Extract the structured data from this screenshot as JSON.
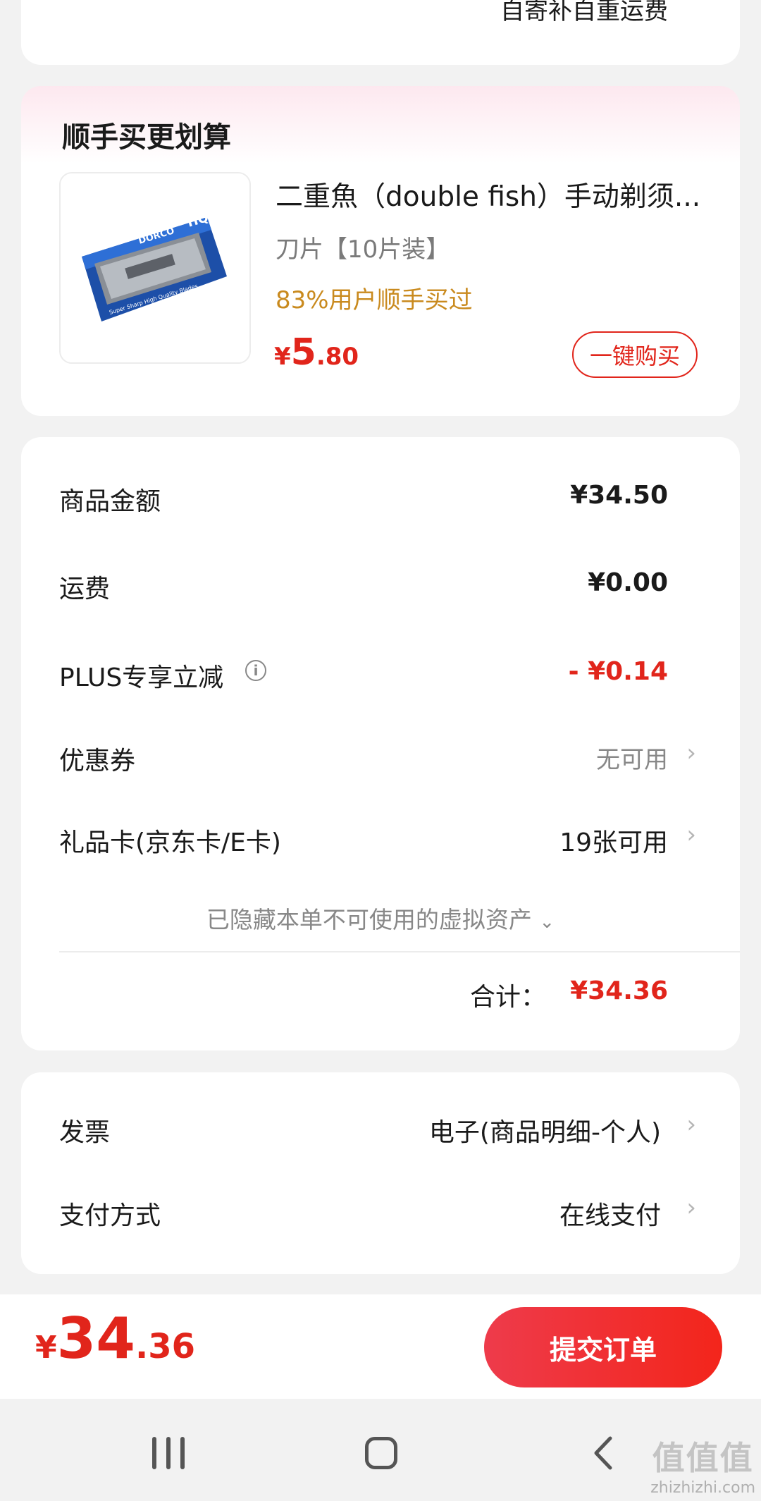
{
  "top_card": {
    "freight_note": "自寄补自重运费"
  },
  "recommend": {
    "title": "顺手买更划算",
    "product": {
      "image_alt": "DORCO HQ Super Sharp High Quality Blades",
      "image_text_brand": "DORCO",
      "image_text_hq": "HQ",
      "image_text_caption": "Super Sharp High Quality Blades",
      "name": "二重魚（double fish）手动剃须刀片",
      "name_display": "二重魚（double fish）手动剃须...",
      "spec": "刀片【10片装】",
      "buy_pct": "83%用户顺手买过",
      "price_symbol": "¥",
      "price_int": "5",
      "price_dec": ".80",
      "buy_button": "一键购买"
    }
  },
  "summary": {
    "goods_amount_label": "商品金额",
    "goods_amount": "¥34.50",
    "freight_label": "运费",
    "freight": "¥0.00",
    "plus_label": "PLUS专享立减",
    "plus_info_icon": "info-icon",
    "plus_value": "- ¥0.14",
    "coupon_label": "优惠券",
    "coupon_value": "无可用",
    "gift_card_label": "礼品卡(京东卡/E卡)",
    "gift_card_value": "19张可用",
    "hidden_note": "已隐藏本单不可使用的虚拟资产",
    "total_label": "合计：",
    "total_value": "¥34.36",
    "colors": {
      "accent": "#e1251b",
      "gold": "#c98a1e"
    }
  },
  "invoice": {
    "invoice_label": "发票",
    "invoice_value": "电子(商品明细-个人)",
    "payment_label": "支付方式",
    "payment_value": "在线支付"
  },
  "bottom_bar": {
    "price_symbol": "¥",
    "price_int": "34",
    "price_dec": ".36",
    "submit_label": "提交订单"
  },
  "watermark": {
    "big": "值值值",
    "small": "zhizhizhi.com"
  }
}
